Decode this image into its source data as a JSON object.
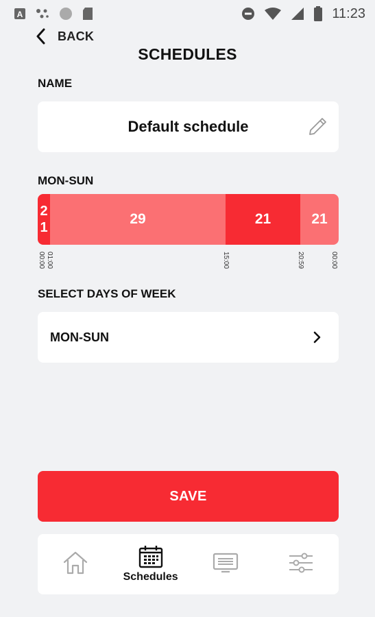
{
  "status_bar": {
    "time": "11:23",
    "left_icons": [
      "a-icon",
      "dots-icon",
      "circle-icon",
      "sd-card-icon"
    ],
    "right_icons": [
      "dnd-icon",
      "wifi-icon",
      "signal-icon",
      "battery-icon"
    ]
  },
  "header": {
    "back_label": "BACK",
    "title": "SCHEDULES"
  },
  "name_section": {
    "label": "NAME",
    "value": "Default schedule"
  },
  "timeline_section": {
    "label": "MON-SUN",
    "segments": [
      {
        "temp_line1": "2",
        "temp_line2": "1",
        "start": "00:00",
        "end": "01:00",
        "color": "#f72b33"
      },
      {
        "temp": "29",
        "start": "01:00",
        "end": "15:00",
        "color": "#fb7073"
      },
      {
        "temp": "21",
        "start": "15:00",
        "end": "20:59",
        "color": "#f72b33"
      },
      {
        "temp": "21",
        "start": "20:59",
        "end": "00:00",
        "color": "#fb7073"
      }
    ],
    "ticks": [
      "00:00",
      "01:00",
      "15:00",
      "20:59",
      "00:00"
    ]
  },
  "days_section": {
    "label": "SELECT DAYS OF WEEK",
    "value": "MON-SUN"
  },
  "save_label": "SAVE",
  "bottom_nav": {
    "items": [
      {
        "icon": "home-icon",
        "label": ""
      },
      {
        "icon": "calendar-icon",
        "label": "Schedules"
      },
      {
        "icon": "display-icon",
        "label": ""
      },
      {
        "icon": "sliders-icon",
        "label": ""
      }
    ]
  },
  "colors": {
    "accent": "#f72b33",
    "accent_light": "#fb7073",
    "background": "#f1f2f4"
  }
}
